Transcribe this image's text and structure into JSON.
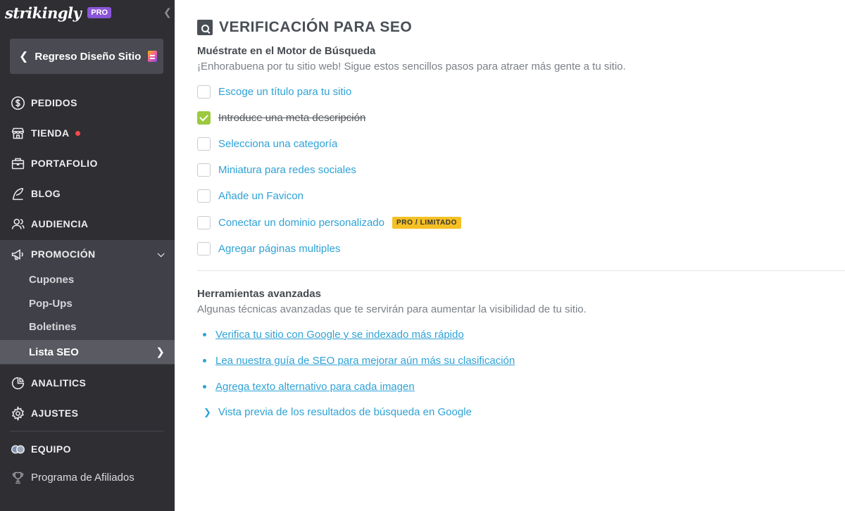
{
  "sidebar": {
    "brand": "strikingly",
    "pro_badge": "PRO",
    "collapse_icon": "chevron-left-icon",
    "back_button": "Regreso Diseño Sitio",
    "nav": {
      "pedidos": "PEDIDOS",
      "tienda": "TIENDA",
      "portafolio": "PORTAFOLIO",
      "blog": "BLOG",
      "audiencia": "AUDIENCIA",
      "promocion": "PROMOCIÓN",
      "analitics": "ANALITICS",
      "ajustes": "AJUSTES",
      "equipo": "EQUIPO",
      "afiliados": "Programa de Afiliados"
    },
    "promo_sub": {
      "cupones": "Cupones",
      "popups": "Pop-Ups",
      "boletines": "Boletines",
      "lista_seo": "Lista SEO"
    },
    "notification_color": "#f24a4a"
  },
  "main": {
    "title": "VERIFICACIÓN PARA SEO",
    "section1": {
      "heading": "Muéstrate en el Motor de Búsqueda",
      "subheading": "¡Enhorabuena por tu sitio web! Sigue estos sencillos pasos para atraer más gente a tu sitio.",
      "items": [
        {
          "label": "Escoge un título para tu sitio",
          "checked": false
        },
        {
          "label": "Introduce una meta descripción",
          "checked": true
        },
        {
          "label": "Selecciona una categoría",
          "checked": false
        },
        {
          "label": "Miniatura para redes sociales",
          "checked": false
        },
        {
          "label": "Añade un Favicon",
          "checked": false
        },
        {
          "label": "Conectar un dominio personalizado",
          "checked": false,
          "badge": "PRO / LIMITADO"
        },
        {
          "label": "Agregar páginas multiples",
          "checked": false
        }
      ]
    },
    "section2": {
      "heading": "Herramientas avanzadas",
      "subheading": "Algunas técnicas avanzadas que te servirán para aumentar la visibilidad de tu sitio.",
      "links": [
        "Verifica tu sitio con Google y se indexado más rápido",
        "Lea nuestra guía de SEO para mejorar aún más su clasificación",
        "Agrega texto alternativo para cada imagen"
      ],
      "preview_link": "Vista previa de los resultados de búsqueda en Google"
    },
    "colors": {
      "link": "#2ea2d6",
      "check": "#9cc93e",
      "badge": "#f5c024"
    }
  }
}
